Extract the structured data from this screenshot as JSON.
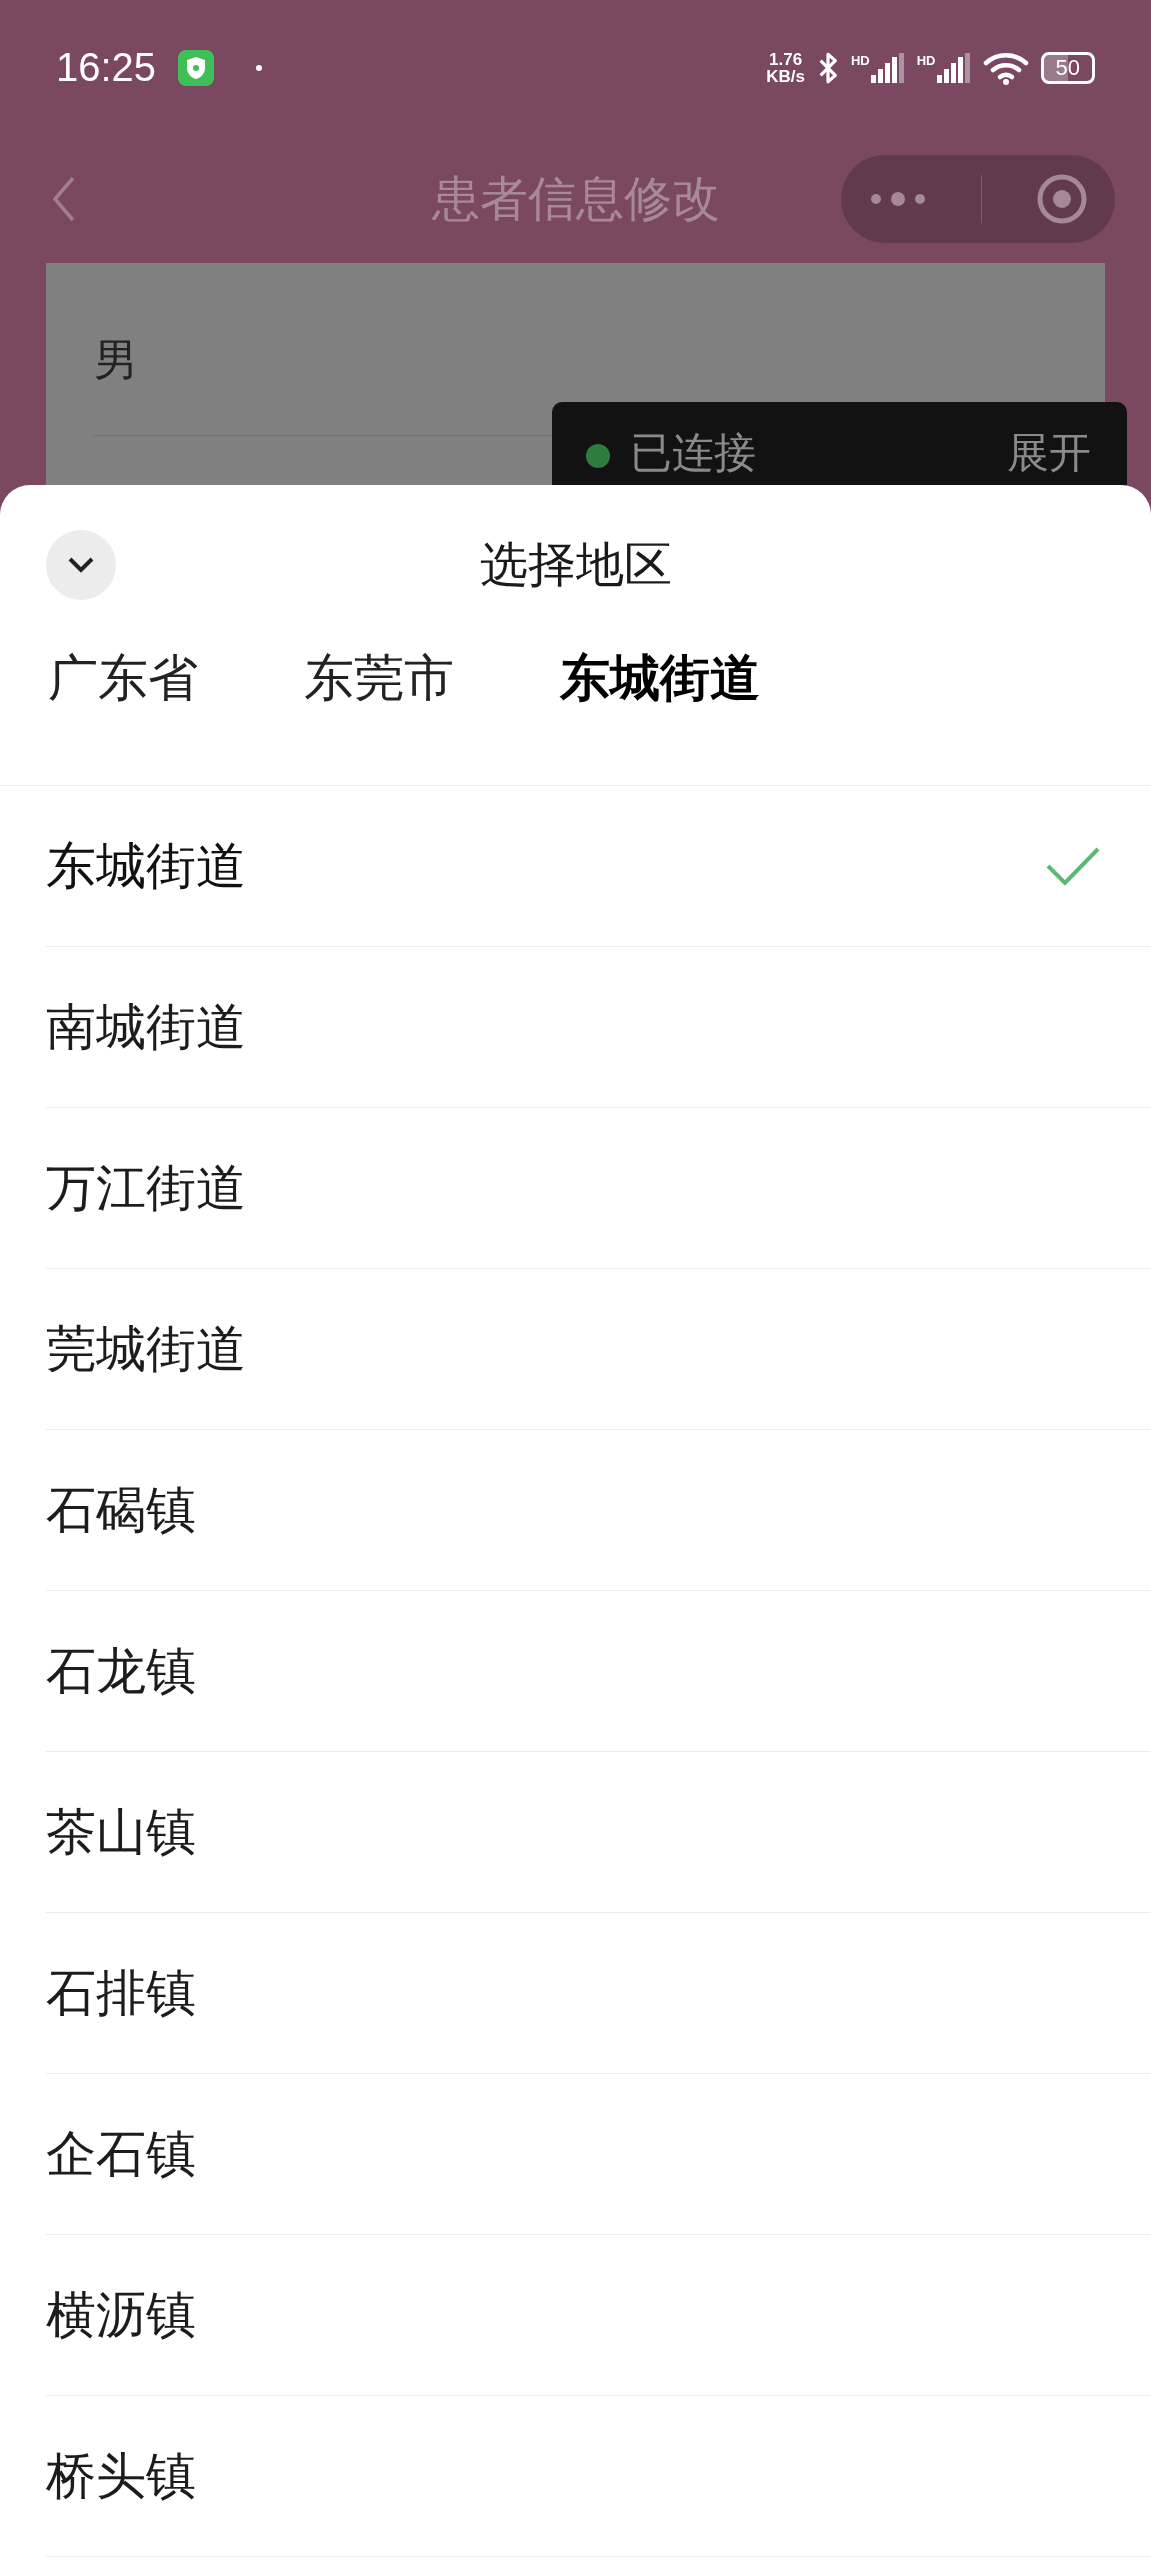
{
  "status_bar": {
    "time": "16:25",
    "speed": "1.76",
    "speed_unit": "KB/s",
    "signals": [
      {
        "label": "HD"
      },
      {
        "label": "HD"
      }
    ],
    "battery": "50"
  },
  "nav": {
    "title": "患者信息修改"
  },
  "form": {
    "value": "男"
  },
  "toast": {
    "status": "已连接",
    "action": "展开"
  },
  "sheet": {
    "title": "选择地区",
    "tabs": [
      {
        "label": "广东省",
        "selected": false
      },
      {
        "label": "东莞市",
        "selected": false
      },
      {
        "label": "东城街道",
        "selected": true
      }
    ],
    "items": [
      {
        "label": "东城街道",
        "selected": true
      },
      {
        "label": "南城街道",
        "selected": false
      },
      {
        "label": "万江街道",
        "selected": false
      },
      {
        "label": "莞城街道",
        "selected": false
      },
      {
        "label": "石碣镇",
        "selected": false
      },
      {
        "label": "石龙镇",
        "selected": false
      },
      {
        "label": "茶山镇",
        "selected": false
      },
      {
        "label": "石排镇",
        "selected": false
      },
      {
        "label": "企石镇",
        "selected": false
      },
      {
        "label": "横沥镇",
        "selected": false
      },
      {
        "label": "桥头镇",
        "selected": false
      }
    ]
  }
}
